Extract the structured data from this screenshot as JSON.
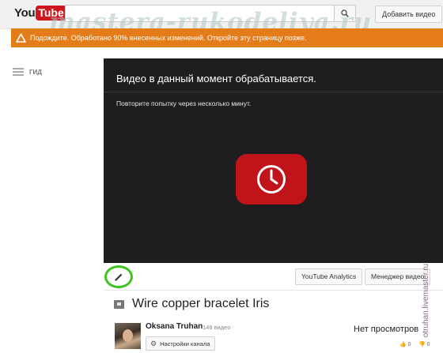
{
  "header": {
    "logo_you": "You",
    "logo_tube": "Tube",
    "logo_region": "UA",
    "upload_label": "Добавить видео"
  },
  "watermark": "mastera-rukodeliya.ru",
  "alert": {
    "text": "Подождите. Обработано 90% внесенных изменений. Откройте эту страницу позже."
  },
  "guide": {
    "label": "ГИД"
  },
  "player": {
    "title": "Видео в данный момент обрабатывается.",
    "message": "Повторите попытку через несколько минут.",
    "icon": "clock-icon",
    "accent": "#c0141a"
  },
  "toolbar": {
    "analytics_label": "YouTube Analytics",
    "manager_label": "Менеджер видео",
    "highlight_color": "#3ec41f"
  },
  "video": {
    "title": "Wire copper bracelet Iris"
  },
  "channel": {
    "name": "Oksana Truhan",
    "video_count": "148 видео",
    "settings_label": "Настройки канала"
  },
  "stats": {
    "views": "Нет просмотров",
    "likes": "0",
    "dislikes": "0"
  },
  "side_watermark": "otruhan.livemaster.ru"
}
